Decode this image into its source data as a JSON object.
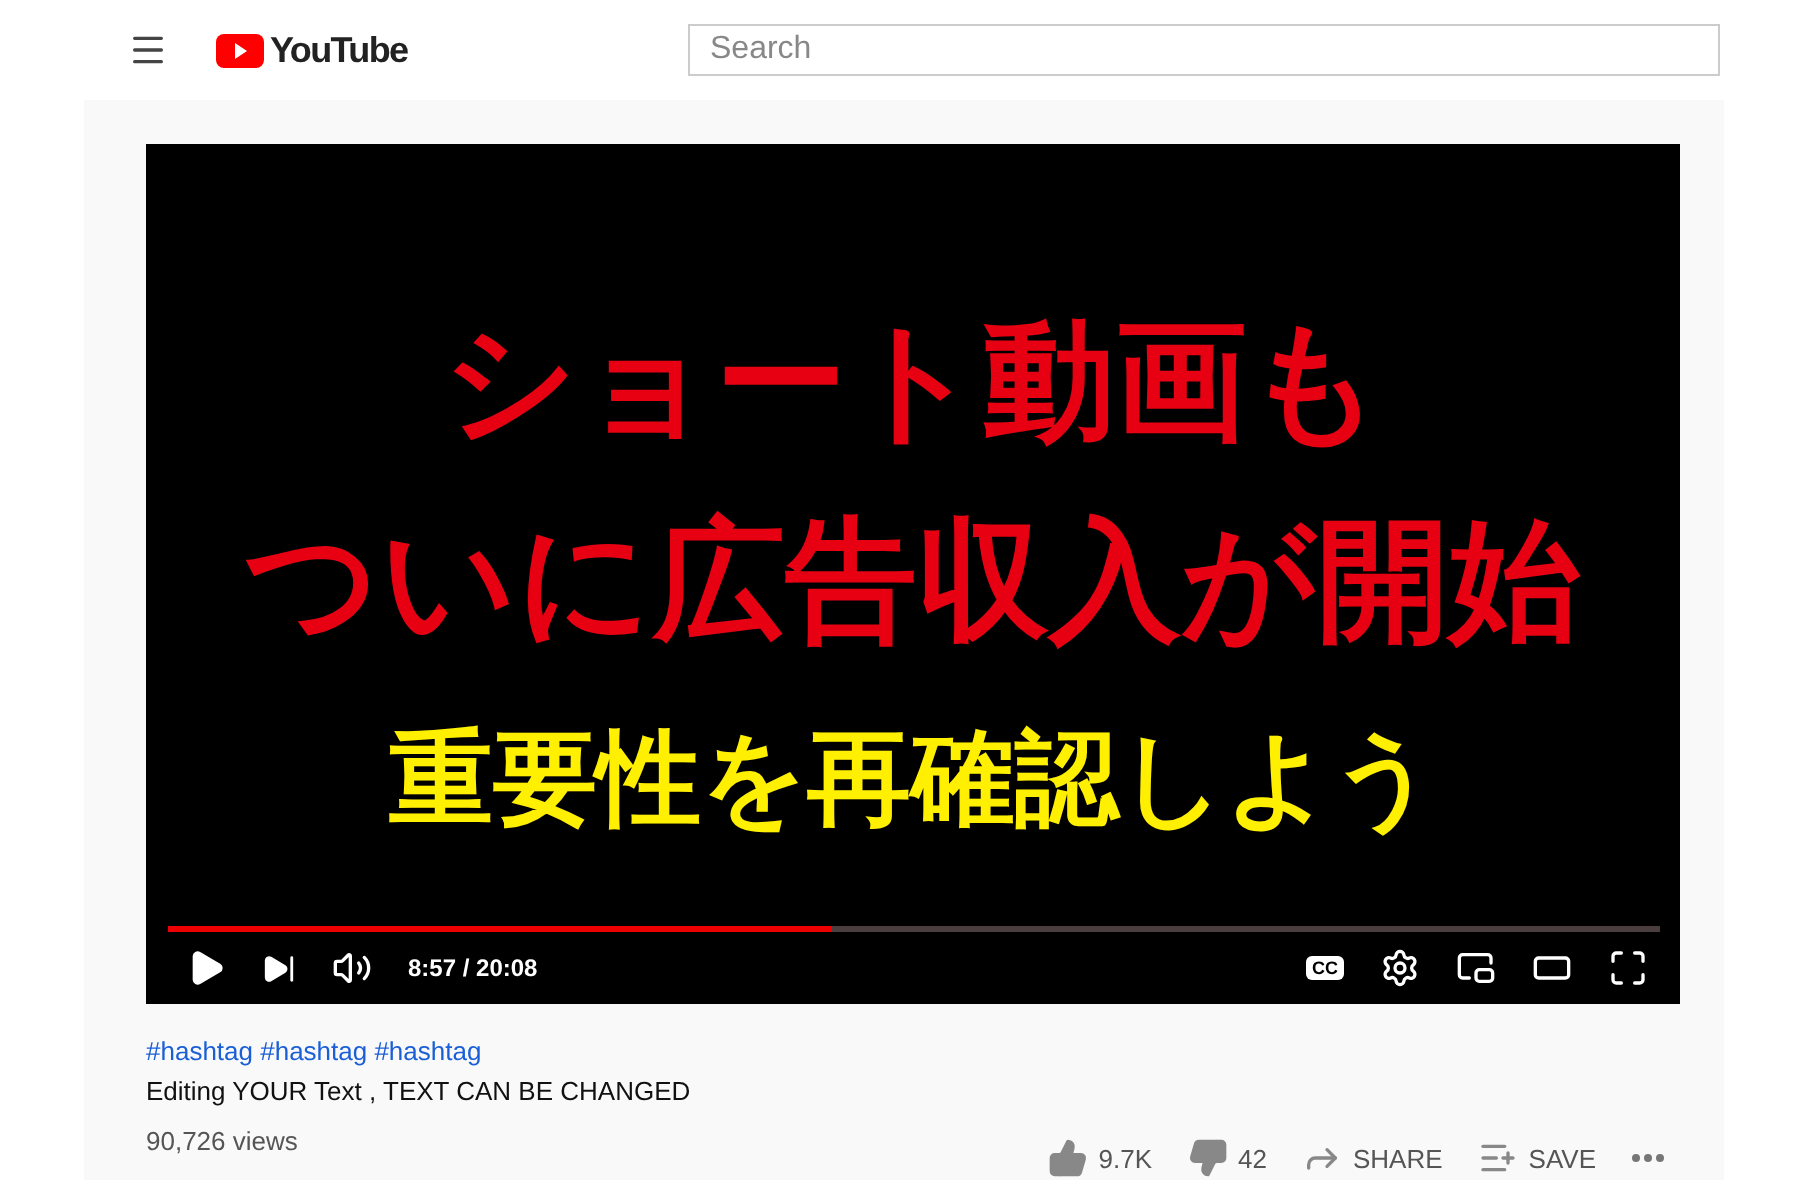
{
  "header": {
    "logo_text": "YouTube",
    "search": {
      "placeholder": "Search"
    }
  },
  "player": {
    "headline_lines": [
      {
        "text": "ショート動画も",
        "kind": "title"
      },
      {
        "text": "ついに広告収入が開始",
        "kind": "title"
      },
      {
        "text": "重要性を再確認しよう",
        "kind": "subtitle"
      }
    ],
    "progress": {
      "level": 0.445
    },
    "time": "8:57 / 20:08",
    "cc_label": "CC"
  },
  "video": {
    "hashtags": "#hashtag #hashtag #hashtag",
    "title": "Editing YOUR Text , TEXT CAN BE CHANGED",
    "views": "90,726 views",
    "actions": [
      {
        "kind": "like",
        "label": "9.7K"
      },
      {
        "kind": "dislike",
        "label": "42"
      },
      {
        "kind": "share",
        "label": "SHARE"
      },
      {
        "kind": "save",
        "label": "SAVE"
      },
      {
        "kind": "more"
      }
    ]
  }
}
